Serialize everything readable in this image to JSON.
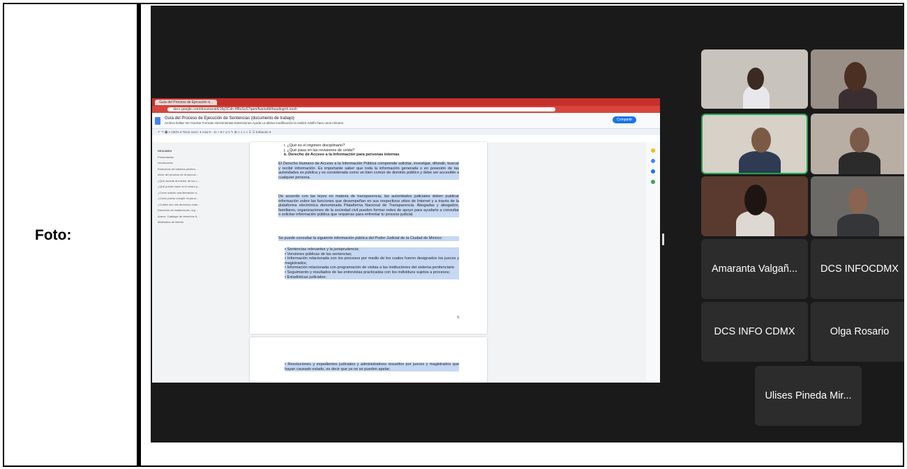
{
  "label": "Foto:",
  "browser": {
    "tab_title": "Guía del Proceso de Ejecución d...",
    "url": "docs.google.com/document/d/1fq/3Cdn-HBoSoS7qam/fwe/edit#heading=h.oooh"
  },
  "doc": {
    "title": "Guía del Proceso de Ejecución de Sentencias (documento de trabajo)",
    "menu": "Archivo  Editar  Ver  Insertar  Formato  Herramientas  Extensiones  Ayuda   La última modificación la realizó Adolfo hace unos minutos",
    "share_label": "Compartir",
    "toolbar": "↶ ↷ 🖶 A 100% ▾  Texto norm. ▾  Arial ▾  -  11  +  B I U A  ✎  ⊞  ≡ ≡ ≡ ≡  ☰ ☰  Editando ▾",
    "outline_heading": "RESUMEN",
    "outline": [
      "RESUMEN",
      "Presentación",
      "Introducción",
      "Estructura del sistema peniten...",
      "Inicio del proceso de la ejecuci...",
      "¿Qué sucede al interior de los c...",
      "¿Qué puedo hacer si el centro p...",
      "¿Cómo solicito una liberación a...",
      "¿Cómo puedo cumplir mi pena...",
      "¿Cuáles son mis derechos cuan...",
      "Directorio de instituciones, org...",
      "Anexo: Catálogo de derechos ti...",
      "Materiales de interés"
    ],
    "list_top": [
      "i.   ¿Qué es el régimen disciplinario?",
      "j.   ¿Qué pasa en las revisiones de celda?",
      "k.   Derecho de Acceso a la Información para personas internas"
    ],
    "para1": "El Derecho Humano de Acceso a la Información Pública comprende solicitar, investigar, difundir, buscar y recibir información. Es importante saber que toda la información generada o en posesión de las autoridades es pública y es considerada como un bien común de dominio público y debe ser accesible a cualquier persona.",
    "para2": "De acuerdo con las leyes en materia de transparencia, las autoridades judiciales deben publicar información sobre las funciones que desempeñan en sus respectivos sitios de Internet y a través de la plataforma electrónica denominada Plataforma Nacional de Transparencia. Abogadas y abogados, familiares, organizaciones de la sociedad civil pueden formar redes de apoyo para ayudarte a consultar o solicitar información pública que requieras para enfrentar tu proceso judicial.",
    "para3": "Se puede consultar la siguiente información pública del Poder Judicial de la Ciudad de México:",
    "bullets": [
      "Sentencias relevantes y la jurisprudencia;",
      "Versiones públicas de las sentencias;",
      "Información relacionada con los procesos por medio de los cuales fueron designados los jueces y magistrados;",
      "Información relacionada con programación de visitas a las instituciones del sistema penitenciario",
      "Seguimiento y resultados de las entrevistas practicadas con los individuos sujetos a procesos;",
      "Estadísticas judiciales;"
    ],
    "page_number": "5",
    "page2_bullet": "Resoluciones y expedientes judiciales y administrativos resueltos por jueces y magistrados que hayan causado estado, es decir que ya no se pueden apelar;"
  },
  "participants": [
    "Amaranta Valgañ...",
    "DCS INFOCDMX",
    "DCS INFO CDMX",
    "Olga Rosario",
    "Ulises Pineda Mir..."
  ]
}
